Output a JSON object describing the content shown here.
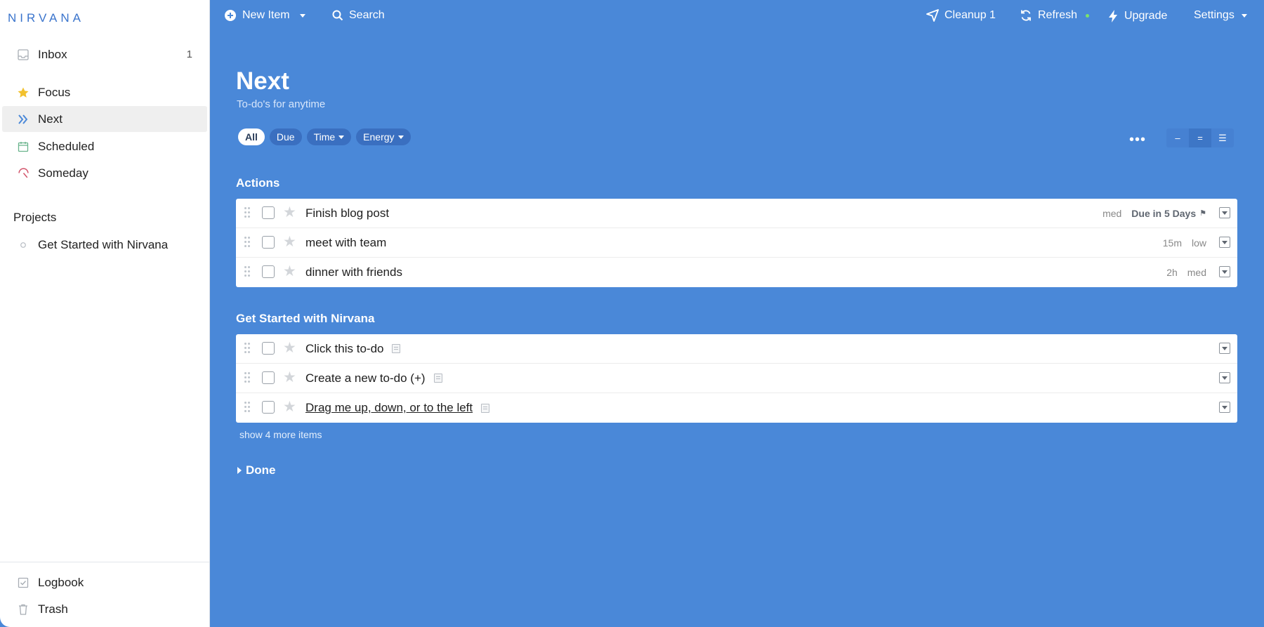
{
  "app": {
    "logo": "NIRVANA"
  },
  "sidebar": {
    "items": [
      {
        "label": "Inbox",
        "icon": "inbox-icon",
        "count": "1"
      },
      {
        "label": "Focus",
        "icon": "star-icon"
      },
      {
        "label": "Next",
        "icon": "chevrons-right-icon",
        "active": true
      },
      {
        "label": "Scheduled",
        "icon": "calendar-icon"
      },
      {
        "label": "Someday",
        "icon": "umbrella-icon"
      }
    ],
    "projects_title": "Projects",
    "projects": [
      {
        "label": "Get Started with Nirvana"
      }
    ],
    "bottom": [
      {
        "label": "Logbook",
        "icon": "logbook-icon"
      },
      {
        "label": "Trash",
        "icon": "trash-icon"
      }
    ]
  },
  "topbar": {
    "new_item": "New Item",
    "search": "Search",
    "cleanup": "Cleanup 1",
    "refresh": "Refresh",
    "upgrade": "Upgrade",
    "settings": "Settings"
  },
  "page": {
    "title": "Next",
    "subtitle": "To-do's for anytime"
  },
  "filters": {
    "all": "All",
    "due": "Due",
    "time": "Time",
    "energy": "Energy"
  },
  "toolbar": {
    "more": "•••",
    "density": [
      "–",
      "=",
      "☰"
    ]
  },
  "sections": {
    "actions": {
      "title": "Actions",
      "rows": [
        {
          "title": "Finish blog post",
          "energy": "med",
          "due": "Due in 5 Days"
        },
        {
          "title": "meet with team",
          "time": "15m",
          "energy": "low"
        },
        {
          "title": "dinner with friends",
          "time": "2h",
          "energy": "med"
        }
      ]
    },
    "project": {
      "title": "Get Started with Nirvana",
      "rows": [
        {
          "title": "Click this to-do"
        },
        {
          "title": "Create a new to-do (+)"
        },
        {
          "title": "Drag me up, down, or to the left"
        }
      ],
      "show_more": "show 4 more items"
    },
    "done": {
      "title": "Done"
    }
  },
  "colors": {
    "accent": "#4a88d8",
    "logo": "#3a74cc",
    "star": "#f2c12e",
    "online": "#7be36a"
  }
}
